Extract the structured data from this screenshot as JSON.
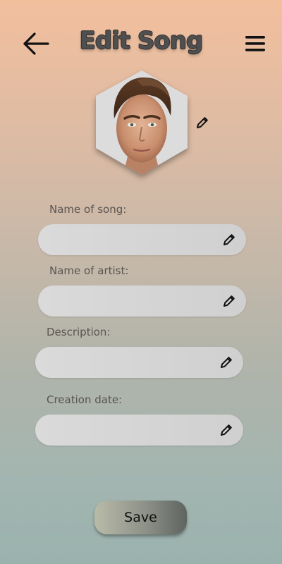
{
  "header": {
    "title": "Edit Song",
    "back_icon": "arrow-left-icon",
    "menu_icon": "hamburger-menu-icon"
  },
  "avatar": {
    "image": "profile-photo",
    "edit_icon": "pencil-icon"
  },
  "form": {
    "fields": [
      {
        "label": "Name of song:",
        "value": "",
        "icon": "pencil-icon"
      },
      {
        "label": "Name of artist:",
        "value": "",
        "icon": "pencil-icon"
      },
      {
        "label": "Description:",
        "value": "",
        "icon": "pencil-icon"
      },
      {
        "label": "Creation date:",
        "value": "",
        "icon": "pencil-icon"
      }
    ],
    "save_label": "Save"
  },
  "colors": {
    "background_top": "#f2bf9d",
    "background_bottom": "#9ab2ae",
    "field_bg": "#d6d6d6",
    "title_text": "#4f4f4f",
    "label_text": "#5a5450"
  }
}
